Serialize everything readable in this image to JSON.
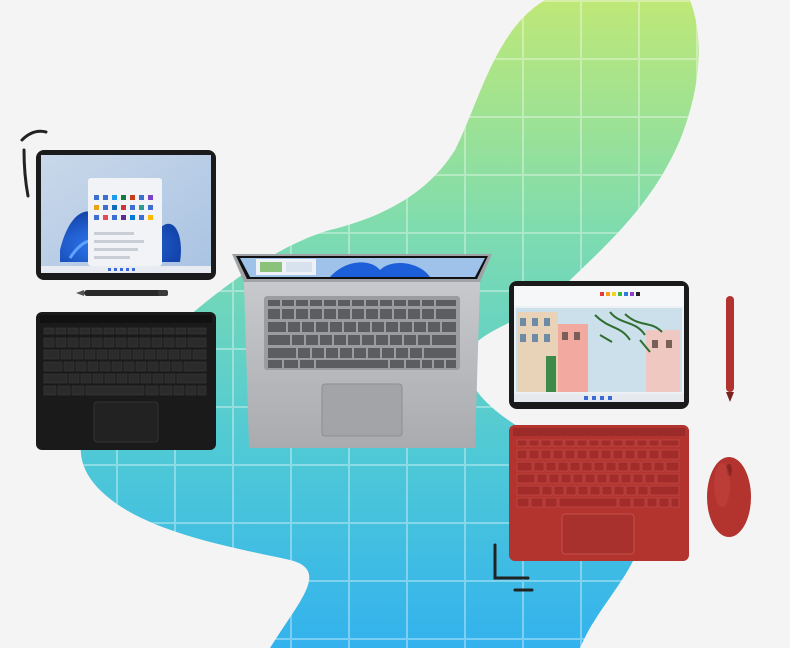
{
  "scene": {
    "description_kind": "product-marketing-image",
    "devices": [
      {
        "name": "tablet-with-black-keyboard",
        "keyboard_color": "#1a1a1a"
      },
      {
        "name": "silver-laptop",
        "body_color": "#b9bbbe"
      },
      {
        "name": "small-tablet-with-red-keyboard",
        "keyboard_color": "#b23a35"
      },
      {
        "name": "red-mouse",
        "color": "#b23a35"
      },
      {
        "name": "black-pen",
        "color": "#2a2a2a"
      },
      {
        "name": "red-pen",
        "color": "#b23a35"
      }
    ],
    "colors": {
      "background": "#f4f4f4",
      "blob_top": "#b5e77a",
      "blob_mid": "#6fdbb2",
      "blob_bottom": "#39b6e8",
      "wallpaper_blue": "#1d5fd8"
    }
  }
}
